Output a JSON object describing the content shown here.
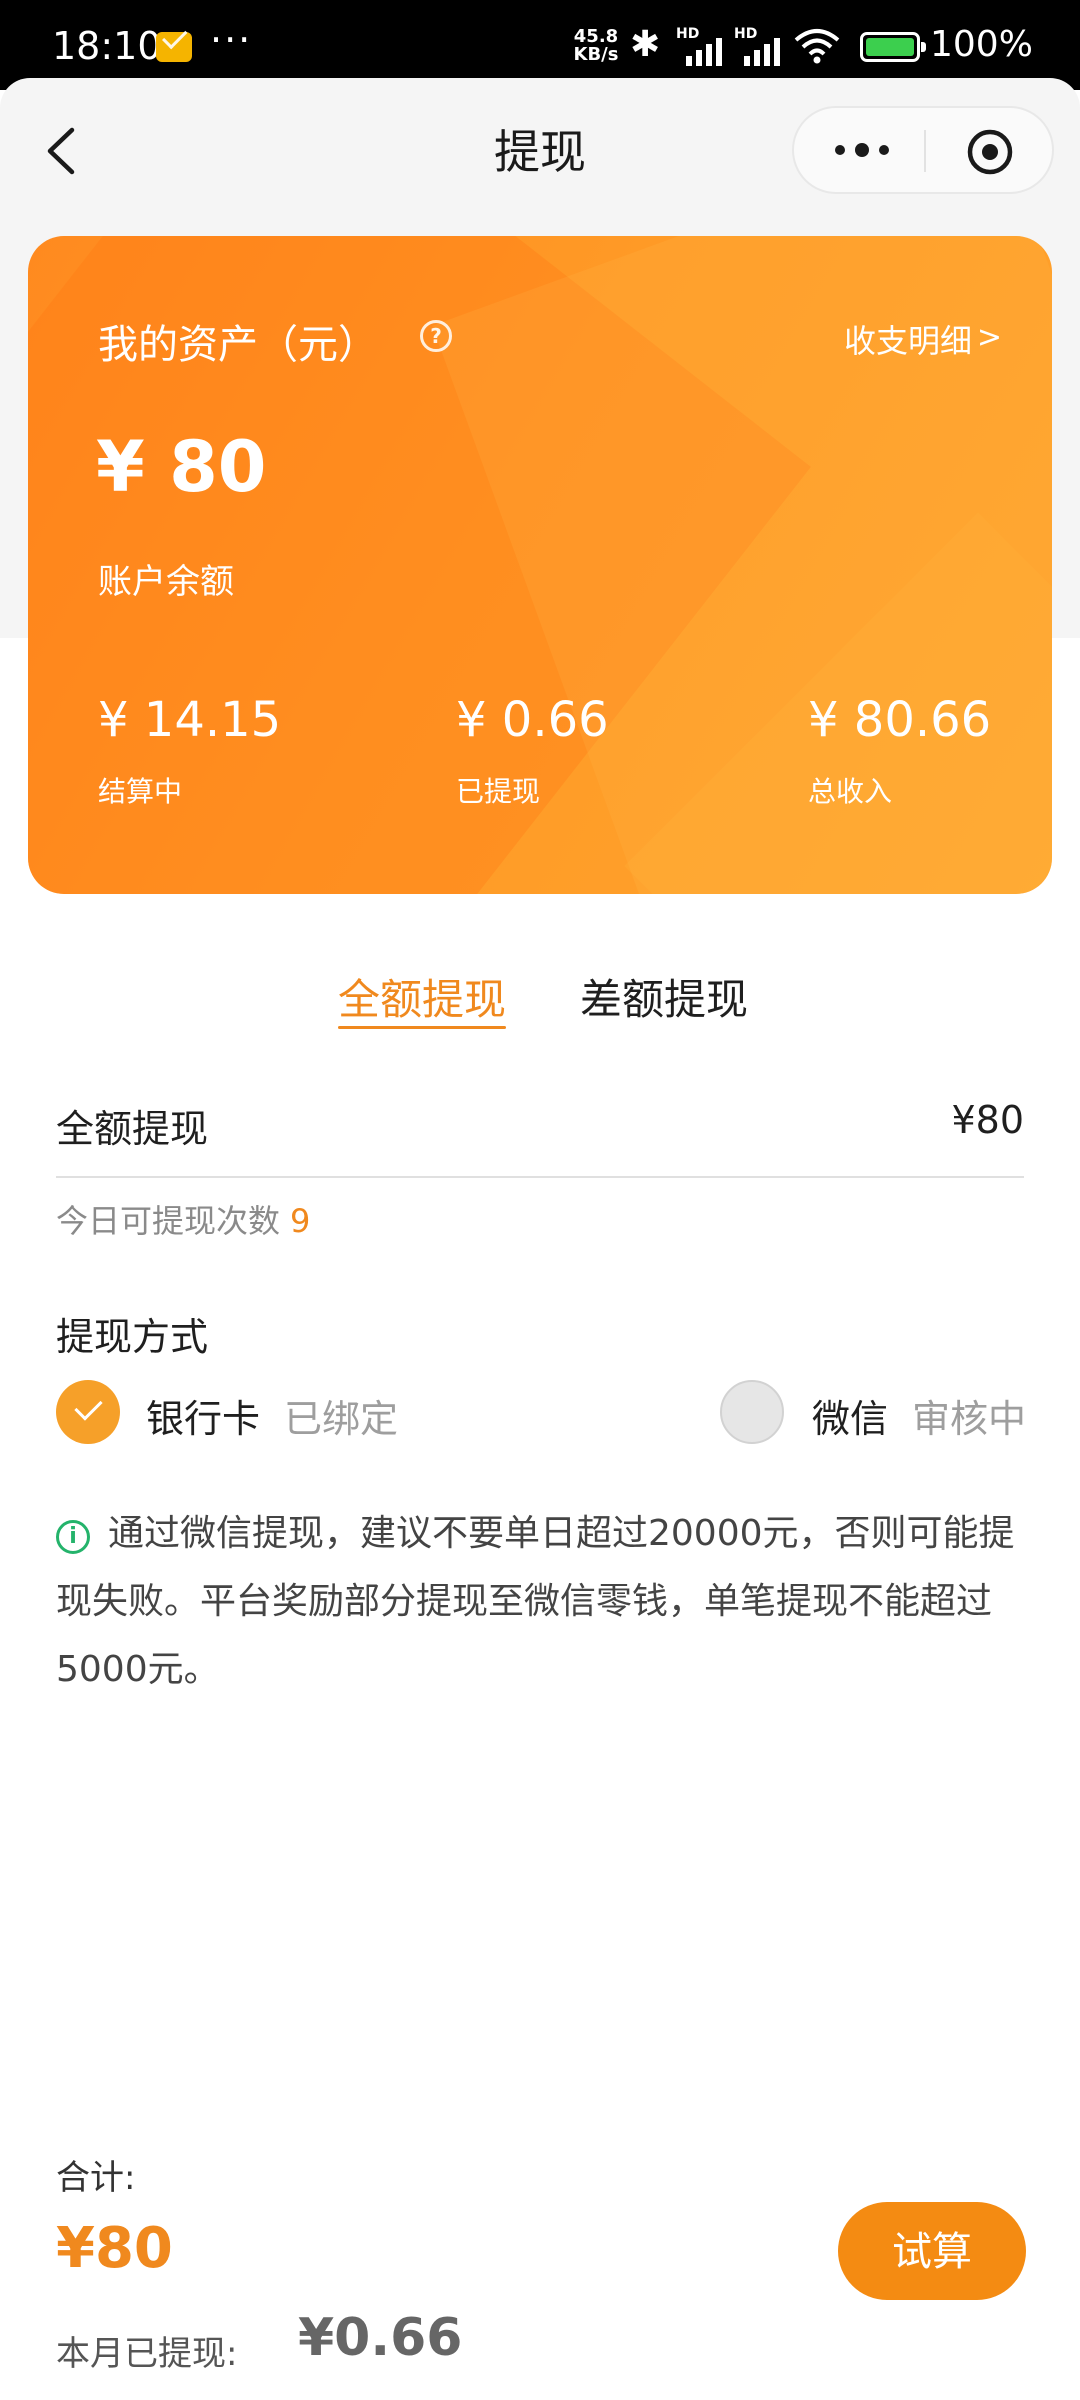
{
  "status_bar": {
    "time": "18:10",
    "more": "···",
    "net_speed_value": "45.8",
    "net_speed_unit": "KB/s",
    "hd1": "HD",
    "hd2": "HD",
    "battery_text": "100%",
    "icons": [
      "mail-icon",
      "bluetooth-icon",
      "signal-icon",
      "wifi-icon",
      "battery-icon"
    ]
  },
  "nav": {
    "title": "提现",
    "icons": [
      "chevron-left-icon",
      "more-dots-icon",
      "target-icon"
    ]
  },
  "card": {
    "assets_label": "我的资产（元）",
    "detail_link": "收支明细",
    "balance": "¥ 80",
    "balance_label": "账户余额",
    "stats": [
      {
        "value": "¥ 14.15",
        "label": "结算中"
      },
      {
        "value": "¥ 0.66",
        "label": "已提现"
      },
      {
        "value": "¥ 80.66",
        "label": "总收入"
      }
    ],
    "colors": {
      "start": "#ff8a1f",
      "end": "#ffa42d"
    }
  },
  "tabs": [
    {
      "label": "全额提现",
      "active": true
    },
    {
      "label": "差额提现",
      "active": false
    }
  ],
  "withdraw": {
    "amount_label": "全额提现",
    "amount_value": "¥80",
    "times_label": "今日可提现次数",
    "times_value": "9"
  },
  "method": {
    "title": "提现方式",
    "options": [
      {
        "name": "银行卡",
        "state": "已绑定",
        "selected": true
      },
      {
        "name": "微信",
        "state": "审核中",
        "selected": false
      }
    ]
  },
  "notice": {
    "text": "通过微信提现，建议不要单日超过20000元，否则可能提现失败。平台奖励部分提现至微信零钱，单笔提现不能超过5000元。"
  },
  "summary": {
    "total_label": "合计:",
    "total_value": "¥80",
    "month_label": "本月已提现:",
    "month_value": "¥0.66",
    "calc_button": "试算"
  },
  "theme": {
    "accent": "#f0891e",
    "button": "#f48b12",
    "info": "#24b36b"
  }
}
